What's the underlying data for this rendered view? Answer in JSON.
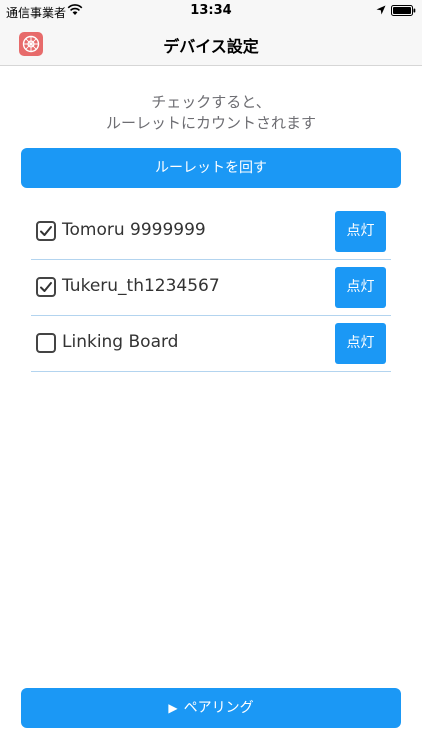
{
  "status_bar": {
    "carrier": "通信事業者",
    "time": "13:34",
    "icons": [
      "wifi-icon",
      "location-icon",
      "battery-icon"
    ]
  },
  "nav": {
    "title": "デバイス設定",
    "app_icon": "roulette-app-icon"
  },
  "instruction": {
    "line1": "チェックすると、",
    "line2": "ルーレットにカウントされます"
  },
  "roulette_button": {
    "label": "ルーレットを回す"
  },
  "devices": [
    {
      "name": "Tomoru 9999999",
      "checked": true,
      "button_label": "点灯"
    },
    {
      "name": "Tukeru_th1234567",
      "checked": true,
      "button_label": "点灯"
    },
    {
      "name": "Linking Board",
      "checked": false,
      "button_label": "点灯"
    }
  ],
  "pairing_button": {
    "glyph": "▶",
    "label": "ペアリング"
  },
  "colors": {
    "accent": "#1b98f5",
    "bar_background": "#f7f7f7",
    "divider": "#b3d4ef",
    "app_icon": "#e76b6b"
  }
}
